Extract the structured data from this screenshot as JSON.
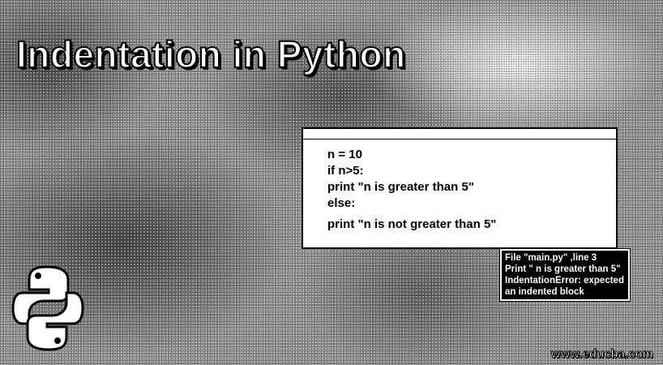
{
  "title": "Indentation in Python",
  "code_window": {
    "lines": [
      "n = 10",
      "if n>5:",
      "print \"n is greater than 5\"",
      "else:",
      "print \"n is not greater than 5\""
    ]
  },
  "error_box": {
    "lines": [
      "File \"main.py\" ,line 3",
      "Print \" n is greater than 5\"",
      "IndentationError: expected",
      "an indented block"
    ]
  },
  "logo": {
    "icon": "python-logo-icon"
  },
  "watermark": "www.educba.com"
}
